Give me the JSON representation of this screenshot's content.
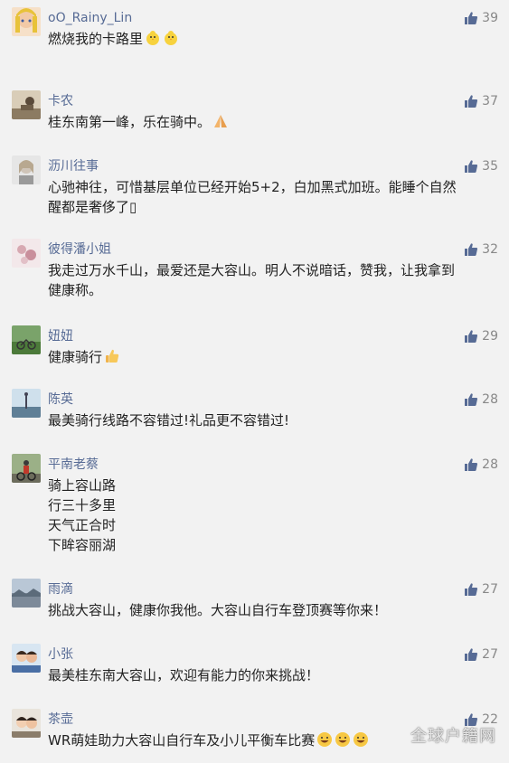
{
  "colors": {
    "background": "#f2f2f2",
    "name": "#576b95",
    "text": "#222222",
    "like": "#576b95",
    "count": "#888888"
  },
  "comments": [
    {
      "name": "oO_Rainy_Lin",
      "likes": "39",
      "lines": [
        "燃烧我的卡路里"
      ],
      "emoji": "chick-icon",
      "emoji_count": 2
    },
    {
      "name": "卡农",
      "likes": "37",
      "lines": [
        "桂东南第一峰，乐在骑中。"
      ],
      "emoji": "praying-hands-icon",
      "emoji_count": 1
    },
    {
      "name": "沥川往事",
      "likes": "35",
      "lines": [
        "心驰神往，可惜基层单位已经开始5+2，白加黑式加班。能睡个自然",
        "醒都是奢侈了▯"
      ]
    },
    {
      "name": "彼得潘小姐",
      "likes": "32",
      "lines": [
        "我走过万水千山，最爱还是大容山。明人不说暗话，赞我，让我拿到",
        "健康称。"
      ]
    },
    {
      "name": "妞妞",
      "likes": "29",
      "lines": [
        "健康骑行"
      ],
      "emoji": "thumbs-up-emoji-icon",
      "emoji_count": 1
    },
    {
      "name": "陈英",
      "likes": "28",
      "lines": [
        "最美骑行线路不容错过!礼品更不容错过!"
      ]
    },
    {
      "name": "平南老蔡",
      "likes": "28",
      "lines": [
        "骑上容山路",
        "行三十多里",
        "天气正合时",
        "下眸容丽湖"
      ]
    },
    {
      "name": "雨滴",
      "likes": "27",
      "lines": [
        "挑战大容山，健康你我他。大容山自行车登顶赛等你来！"
      ]
    },
    {
      "name": "小张",
      "likes": "27",
      "lines": [
        "最美桂东南大容山，欢迎有能力的你来挑战！"
      ]
    },
    {
      "name": "茶壶",
      "likes": "22",
      "lines": [
        "WR萌娃助力大容山自行车及小儿平衡车比赛"
      ],
      "emoji": "grinning-face-icon",
      "emoji_count": 3
    }
  ],
  "watermark": "全球户籍网"
}
